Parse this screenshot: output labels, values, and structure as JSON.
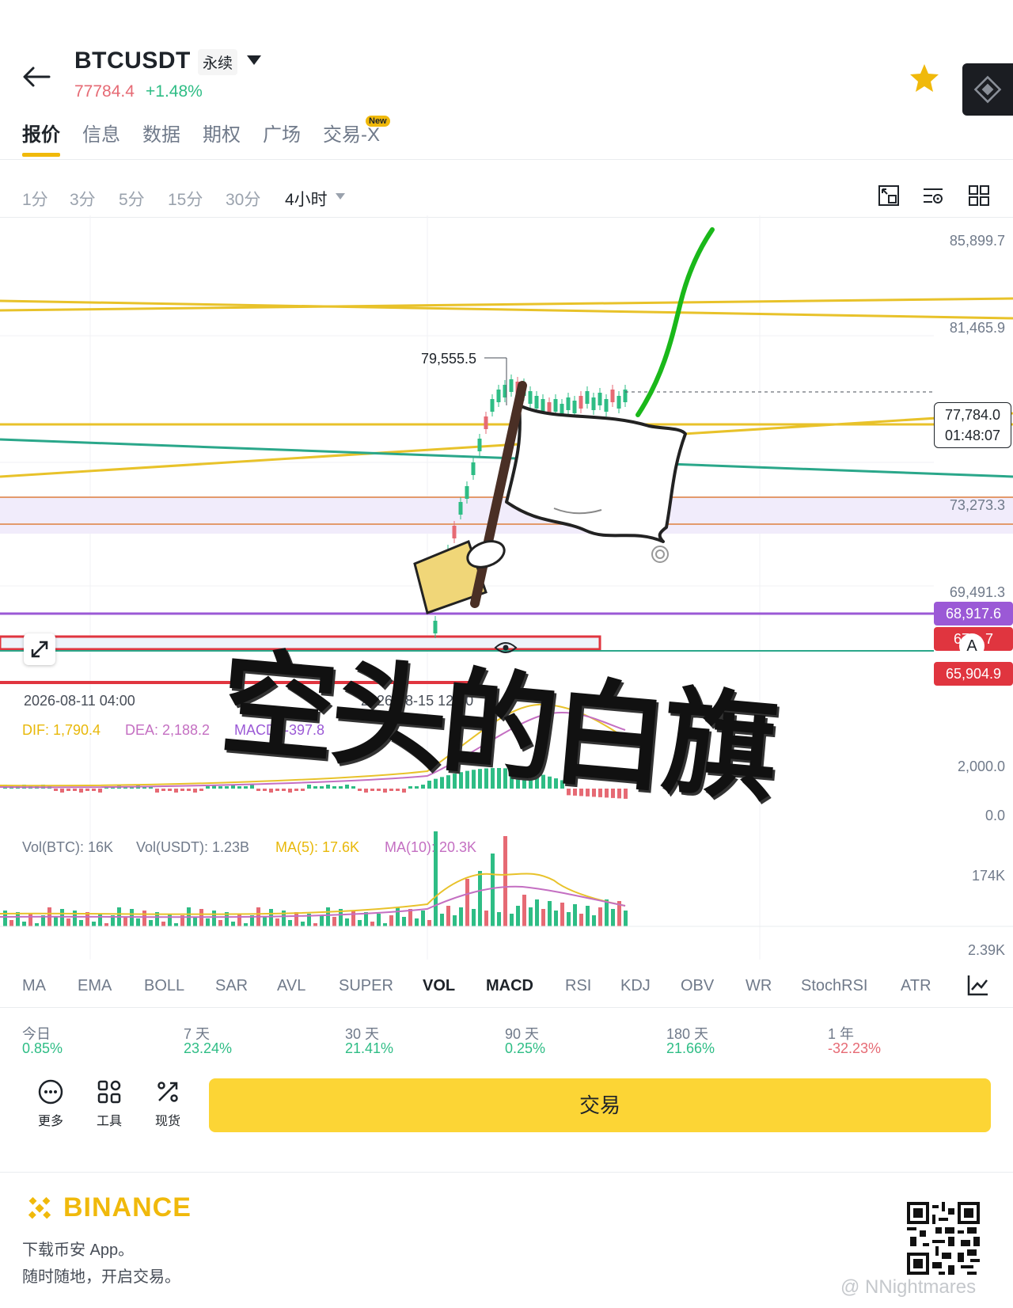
{
  "header": {
    "symbol": "BTCUSDT",
    "contract_type": "永续",
    "last_price": "77784.4",
    "change_pct": "+1.48%"
  },
  "tabs": [
    "报价",
    "信息",
    "数据",
    "期权",
    "广场",
    "交易-X"
  ],
  "new_badge": "New",
  "intervals": [
    "1分",
    "3分",
    "5分",
    "15分",
    "30分",
    "4小时"
  ],
  "price_axis": [
    "85,899.7",
    "81,465.9",
    "73,273.3",
    "69,491.3"
  ],
  "current_price_box": {
    "price": "77,784.0",
    "countdown": "01:48:07"
  },
  "tags": {
    "purple": "68,917.6",
    "red_top": "67,...7",
    "red_bottom": "65,904.9",
    "alert": "A"
  },
  "annotations": {
    "high": "79,555.5"
  },
  "time_axis": [
    "2026-08-11 04:00",
    "2026-08-15 12:00"
  ],
  "macd": {
    "dif": "DIF: 1,790.4",
    "dea": "DEA: 2,188.2",
    "macd": "MACD: -397.8",
    "axis_top": "2,000.0",
    "axis_zero": "0.0"
  },
  "volume": {
    "btc": "Vol(BTC): 16K",
    "usdt": "Vol(USDT): 1.23B",
    "ma5": "MA(5): 17.6K",
    "ma10": "MA(10): 20.3K",
    "axis_top": "174K",
    "axis_bottom": "2.39K"
  },
  "overlay_caption": "空头的白旗",
  "indicator_tabs": [
    "MA",
    "EMA",
    "BOLL",
    "SAR",
    "AVL",
    "SUPER",
    "VOL",
    "MACD",
    "RSI",
    "KDJ",
    "OBV",
    "WR",
    "StochRSI",
    "ATR"
  ],
  "performance": [
    {
      "label": "今日",
      "value": "0.85%",
      "color": "#2ebd85"
    },
    {
      "label": "7 天",
      "value": "23.24%",
      "color": "#2ebd85"
    },
    {
      "label": "30 天",
      "value": "21.41%",
      "color": "#2ebd85"
    },
    {
      "label": "90 天",
      "value": "0.25%",
      "color": "#2ebd85"
    },
    {
      "label": "180 天",
      "value": "21.66%",
      "color": "#2ebd85"
    },
    {
      "label": "1 年",
      "value": "-32.23%",
      "color": "#e66a74"
    }
  ],
  "actions": [
    "更多",
    "工具",
    "现货"
  ],
  "trade_button": "交易",
  "footer": {
    "brand": "BINANCE",
    "line1": "下载币安 App。",
    "line2": "随时随地，开启交易。",
    "watermark": "@ NNightmares"
  },
  "colors": {
    "up": "#2ebd85",
    "down": "#e66a74",
    "accent": "#f0b90b",
    "trade": "#fcd535",
    "purple": "#9b59d6"
  }
}
